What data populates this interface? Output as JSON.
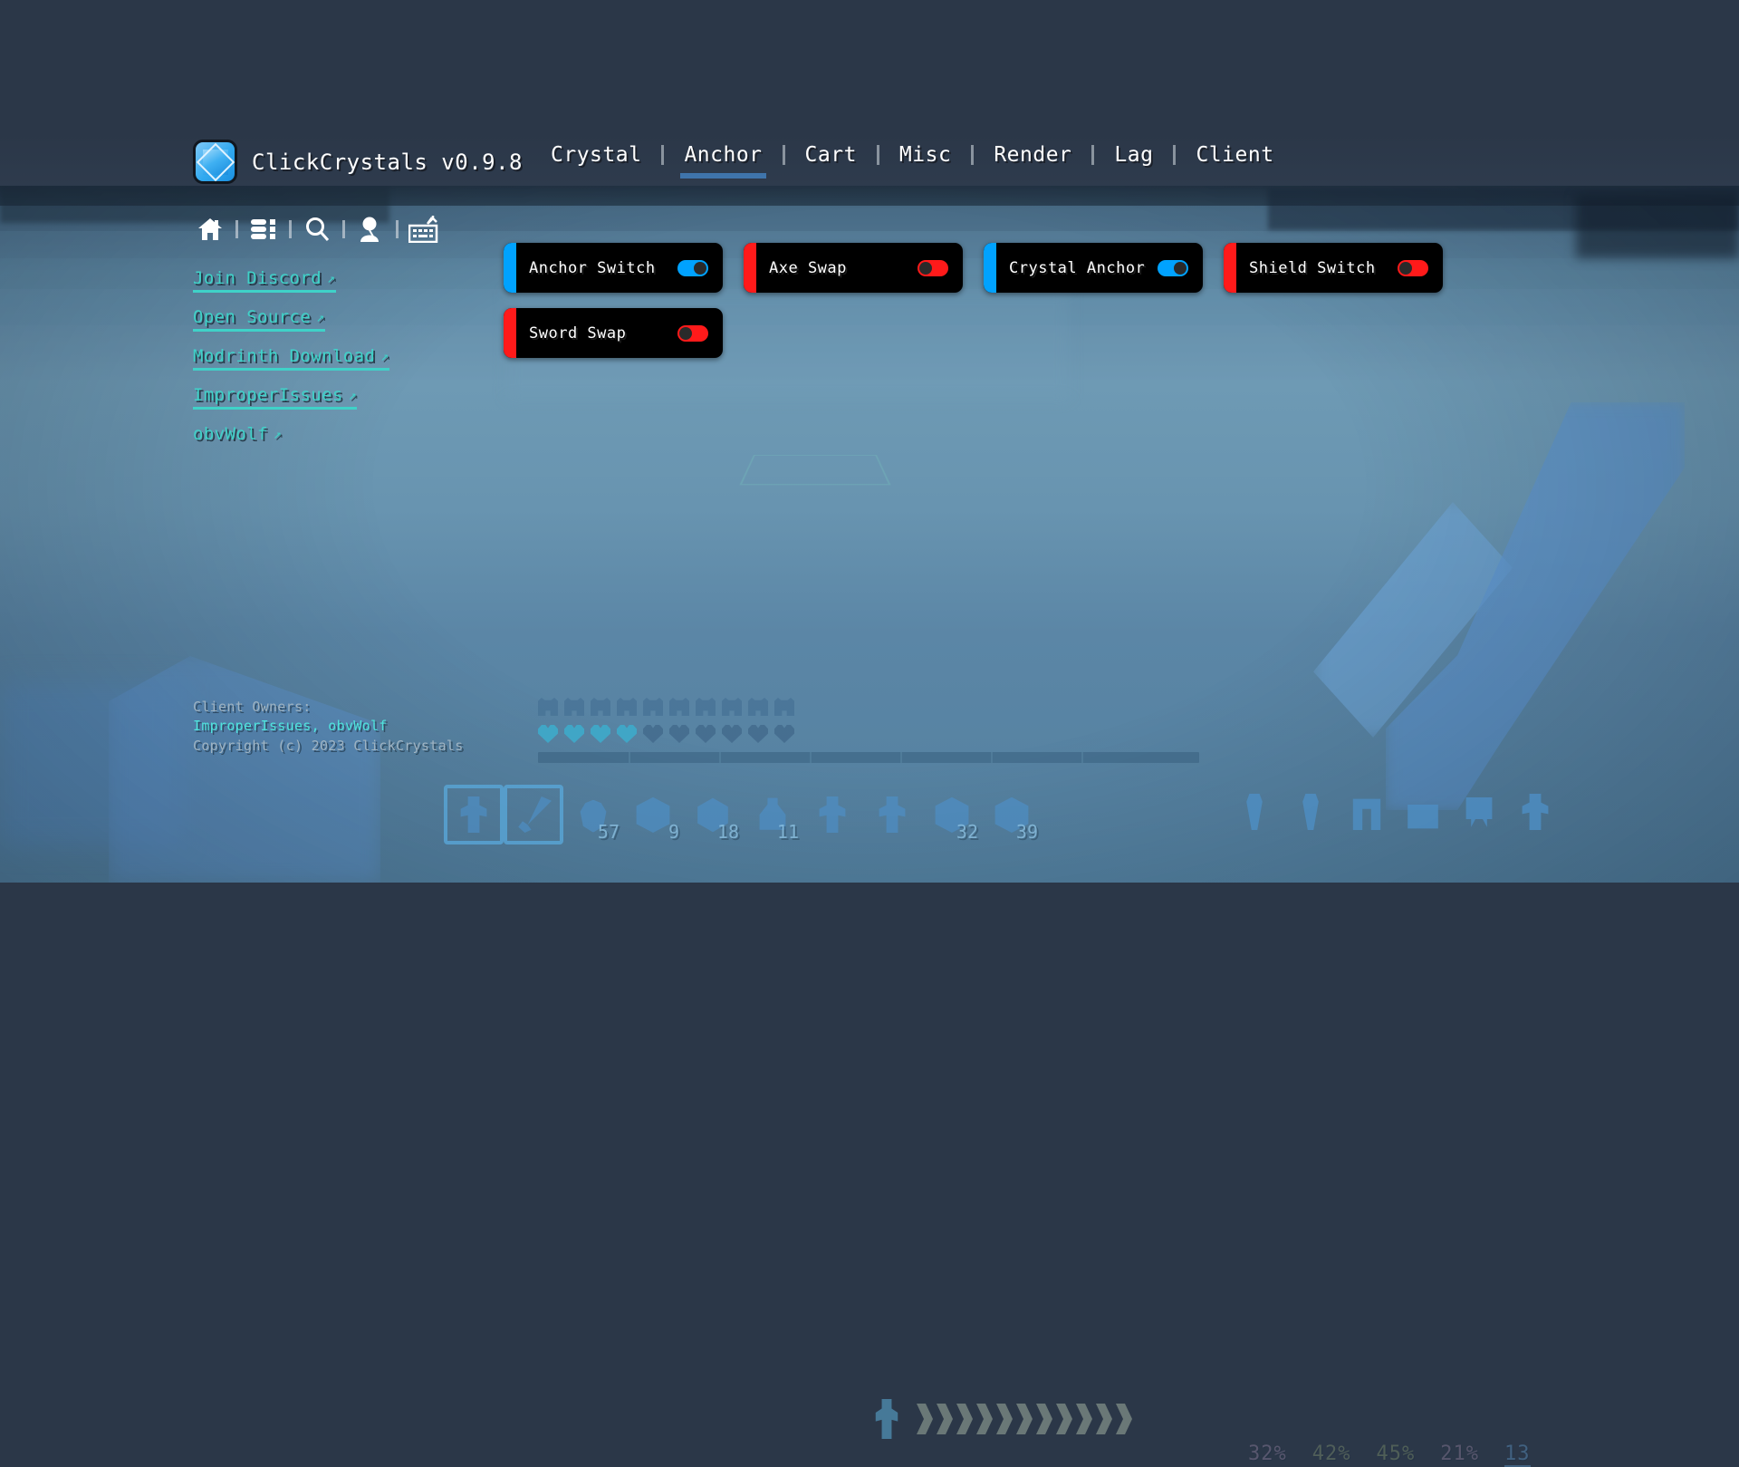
{
  "app": {
    "title": "ClickCrystals v0.9.8",
    "logo_icon": "crystal-logo-icon",
    "accent_blue": "#00a2ff",
    "accent_red": "#ff1a1a",
    "link_color": "#3fd2c8",
    "tab_indicator_color": "#3f74ab"
  },
  "tabs": [
    {
      "label": "Crystal",
      "active": false
    },
    {
      "label": "Anchor",
      "active": true
    },
    {
      "label": "Cart",
      "active": false
    },
    {
      "label": "Misc",
      "active": false
    },
    {
      "label": "Render",
      "active": false
    },
    {
      "label": "Lag",
      "active": false
    },
    {
      "label": "Client",
      "active": false
    }
  ],
  "sidebar": {
    "icons": [
      {
        "name": "home-icon",
        "label": "Home",
        "active": true
      },
      {
        "name": "modules-icon",
        "label": "Modules",
        "active": false
      },
      {
        "name": "search-icon",
        "label": "Search",
        "active": false
      },
      {
        "name": "player-icon",
        "label": "Player",
        "active": false
      },
      {
        "name": "keybinds-icon",
        "label": "Keybinds",
        "active": false
      }
    ],
    "links": [
      {
        "label": "Join Discord",
        "ext": "↗",
        "underlined": true
      },
      {
        "label": "Open Source",
        "ext": "↗",
        "underlined": true
      },
      {
        "label": "Modrinth Download",
        "ext": "↗",
        "underlined": true
      },
      {
        "label": "ImproperIssues",
        "ext": "↗",
        "underlined": true
      },
      {
        "label": "obvWolf",
        "ext": "↗",
        "underlined": false
      }
    ]
  },
  "modules": [
    {
      "name": "Anchor Switch",
      "enabled": true,
      "color": "#00a2ff"
    },
    {
      "name": "Axe Swap",
      "enabled": false,
      "color": "#ff1a1a"
    },
    {
      "name": "Crystal Anchor",
      "enabled": true,
      "color": "#00a2ff"
    },
    {
      "name": "Shield Switch",
      "enabled": false,
      "color": "#ff1a1a"
    },
    {
      "name": "Sword Swap",
      "enabled": false,
      "color": "#ff1a1a"
    }
  ],
  "credits": {
    "owners_label": "Client Owners:",
    "owners": "ImproperIssues, obvWolf",
    "copyright": "Copyright (c) 2023 ClickCrystals"
  },
  "hud": {
    "armor_points": 10,
    "hearts_total": 10,
    "hearts_full": 4,
    "hotbar": [
      {
        "item": "totem-of-undying",
        "count": "",
        "selected": true
      },
      {
        "item": "diamond-sword",
        "count": "",
        "selected": true
      },
      {
        "item": "golden-apple",
        "count": "57",
        "selected": false
      },
      {
        "item": "obsidian-block",
        "count": "9",
        "selected": false
      },
      {
        "item": "ender-chest",
        "count": "18",
        "selected": false
      },
      {
        "item": "splash-potion",
        "count": "11",
        "selected": false
      },
      {
        "item": "totem-of-undying",
        "count": "",
        "selected": false
      },
      {
        "item": "totem-of-undying",
        "count": "",
        "selected": false
      },
      {
        "item": "obsidian-block",
        "count": "32",
        "selected": false
      },
      {
        "item": "end-crystal",
        "count": "39",
        "selected": false
      }
    ],
    "perf": [
      {
        "value": "32%",
        "tone": "0"
      },
      {
        "value": "42%",
        "tone": "1"
      },
      {
        "value": "45%",
        "tone": "2"
      },
      {
        "value": "21%",
        "tone": "3"
      },
      {
        "value": "13",
        "tone": "4"
      }
    ]
  }
}
